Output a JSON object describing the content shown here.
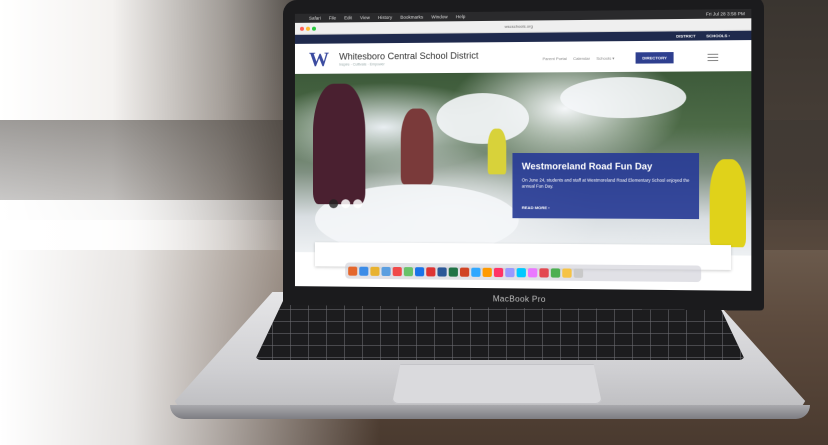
{
  "menubar": {
    "apple": "",
    "items": [
      "Safari",
      "File",
      "Edit",
      "View",
      "History",
      "Bookmarks",
      "Window",
      "Help"
    ],
    "clock": "Fri Jul 28 3:58 PM"
  },
  "browser": {
    "url": "wscschools.org"
  },
  "site": {
    "utility_links": [
      "DISTRICT",
      "SCHOOLS ›"
    ],
    "logo_letter": "W",
    "district_name": "Whitesboro Central School District",
    "tagline": "Inspire · Cultivate · Empower",
    "nav": [
      "Parent Portal",
      "Calendar",
      "Schools ▾"
    ],
    "directory_button": "DIRECTORY"
  },
  "hero": {
    "title": "Westmoreland Road Fun Day",
    "body": "On June 24, students and staff at Westmoreland Road Elementary School enjoyed the annual Fun Day.",
    "read_more": "READ MORE ›"
  },
  "laptop": {
    "label": "MacBook Pro"
  },
  "colors": {
    "brand_navy": "#1f2a4d",
    "brand_blue": "#2e3f8f",
    "caption_blue": "#283c96"
  }
}
